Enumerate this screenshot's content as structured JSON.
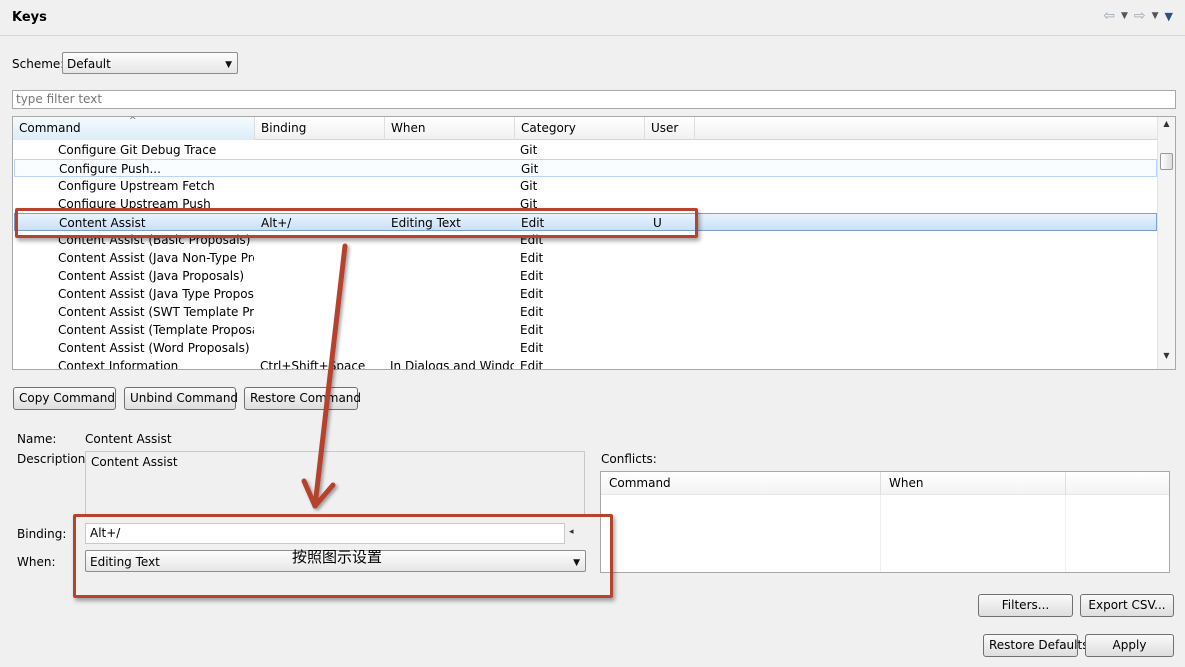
{
  "header": {
    "title": "Keys"
  },
  "scheme": {
    "label": "Scheme:",
    "value": "Default"
  },
  "filter": {
    "placeholder": "type filter text"
  },
  "table": {
    "columns": [
      "Command",
      "Binding",
      "When",
      "Category",
      "User"
    ],
    "rows": [
      {
        "command": "Configure Git Debug Trace",
        "binding": "",
        "when": "",
        "category": "Git",
        "user": ""
      },
      {
        "command": "Configure Push...",
        "binding": "",
        "when": "",
        "category": "Git",
        "user": ""
      },
      {
        "command": "Configure Upstream Fetch",
        "binding": "",
        "when": "",
        "category": "Git",
        "user": ""
      },
      {
        "command": "Configure Upstream Push",
        "binding": "",
        "when": "",
        "category": "Git",
        "user": ""
      },
      {
        "command": "Content Assist",
        "binding": "Alt+/",
        "when": "Editing Text",
        "category": "Edit",
        "user": "U"
      },
      {
        "command": "Content Assist (Basic Proposals)",
        "binding": "",
        "when": "",
        "category": "Edit",
        "user": ""
      },
      {
        "command": "Content Assist (Java Non-Type Propo",
        "binding": "",
        "when": "",
        "category": "Edit",
        "user": ""
      },
      {
        "command": "Content Assist (Java Proposals)",
        "binding": "",
        "when": "",
        "category": "Edit",
        "user": ""
      },
      {
        "command": "Content Assist (Java Type Proposals)",
        "binding": "",
        "when": "",
        "category": "Edit",
        "user": ""
      },
      {
        "command": "Content Assist (SWT Template Propos",
        "binding": "",
        "when": "",
        "category": "Edit",
        "user": ""
      },
      {
        "command": "Content Assist (Template Proposals)",
        "binding": "",
        "when": "",
        "category": "Edit",
        "user": ""
      },
      {
        "command": "Content Assist (Word Proposals)",
        "binding": "",
        "when": "",
        "category": "Edit",
        "user": ""
      },
      {
        "command": "Context Information",
        "binding": "Ctrl+Shift+Space",
        "when": "In Dialogs and Windo...",
        "category": "Edit",
        "user": ""
      }
    ]
  },
  "buttons": {
    "copy": "Copy Command",
    "unbind": "Unbind Command",
    "restore": "Restore Command",
    "filters": "Filters...",
    "export": "Export CSV...",
    "restore_defaults": "Restore Defaults",
    "apply": "Apply"
  },
  "details": {
    "name_label": "Name:",
    "name_value": "Content Assist",
    "description_label": "Description:",
    "description_value": "Content Assist",
    "binding_label": "Binding:",
    "binding_value": "Alt+/",
    "when_label": "When:",
    "when_value": "Editing Text"
  },
  "conflicts": {
    "label": "Conflicts:",
    "columns": [
      "Command",
      "When"
    ]
  },
  "annotation": {
    "text": "按照图示设置",
    "color": "#b5432d"
  }
}
